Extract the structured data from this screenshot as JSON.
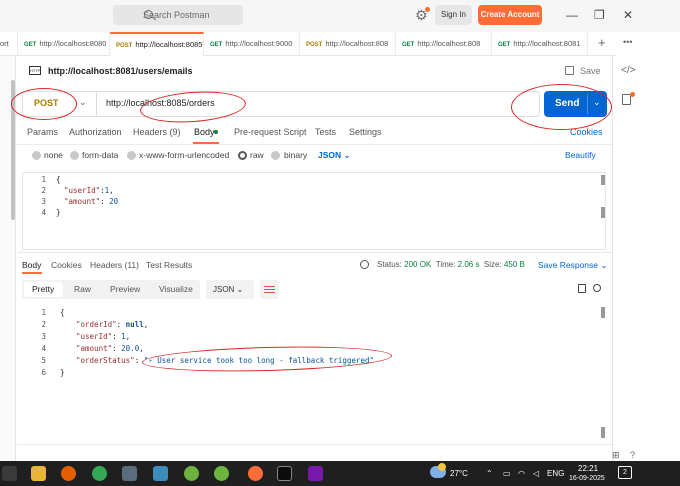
{
  "titlebar": {
    "search_placeholder": "Search Postman",
    "sign_in": "Sign In",
    "create_account": "Create Account"
  },
  "tabs": [
    {
      "label": "ort",
      "method": ""
    },
    {
      "label": "http://localhost:8080",
      "method": "GET"
    },
    {
      "label": "http://localhost:8085",
      "method": "POST"
    },
    {
      "label": "http://localhost:9000",
      "method": "GET"
    },
    {
      "label": "http://localhost:808",
      "method": "POST"
    },
    {
      "label": "http://localhost:808",
      "method": "GET"
    },
    {
      "label": "http://localhost:8081",
      "method": "GET"
    }
  ],
  "request": {
    "title": "http://localhost:8081/users/emails",
    "save": "Save",
    "method": "POST",
    "url": "http://localhost:8085/orders",
    "send": "Send",
    "tabs": [
      "Params",
      "Authorization",
      "Headers (9)",
      "Body",
      "Pre-request Script",
      "Tests",
      "Settings"
    ],
    "cookies": "Cookies",
    "body_types": [
      "none",
      "form-data",
      "x-www-form-urlencoded",
      "raw",
      "binary"
    ],
    "body_format": "JSON",
    "beautify": "Beautify",
    "body_lines": [
      "1",
      "2",
      "3",
      "4"
    ]
  },
  "response": {
    "tabs": [
      "Body",
      "Cookies",
      "Headers (11)",
      "Test Results"
    ],
    "status_label": "Status:",
    "status_value": "200 OK",
    "time_label": "Time:",
    "time_value": "2.06 s",
    "size_label": "Size:",
    "size_value": "450 B",
    "save_response": "Save Response",
    "view_modes": [
      "Pretty",
      "Raw",
      "Preview",
      "Visualize"
    ],
    "format": "JSON",
    "lines": [
      "1",
      "2",
      "3",
      "4",
      "5",
      "6"
    ],
    "order_id_value": "null",
    "user_id_value": "1",
    "amount_value": "20.0",
    "order_status_value": "\"⚡ User service took too long - fallback triggered\""
  },
  "taskbar": {
    "temperature": "27°C",
    "language": "ENG",
    "time": "22:21",
    "date": "16-09-2025",
    "notifications": "2"
  },
  "colors": {
    "accent": "#ff6c37",
    "send": "#0265d2",
    "post": "#ad7a03",
    "get": "#0b8043",
    "annotation": "#d62929"
  }
}
